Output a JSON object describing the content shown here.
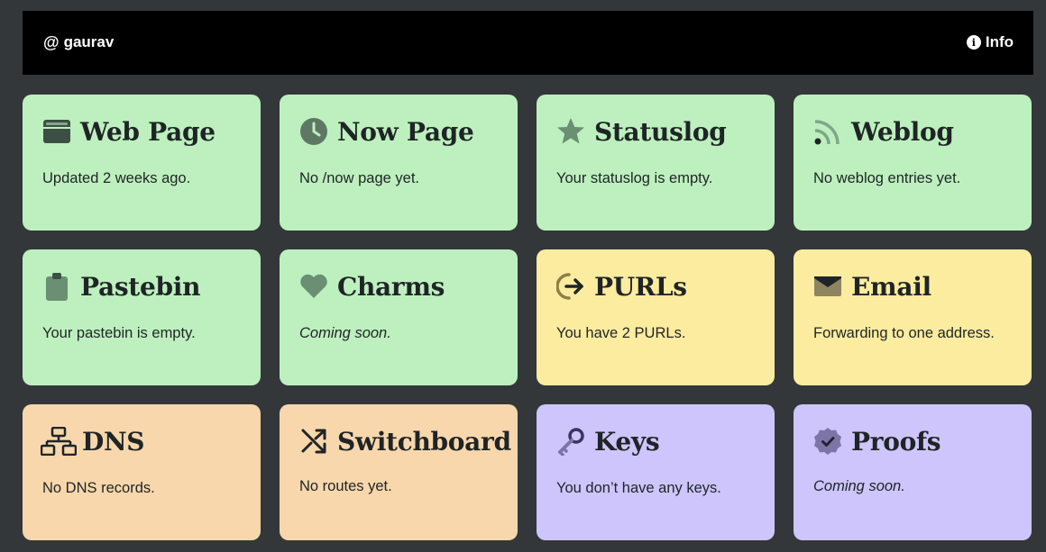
{
  "header": {
    "user_symbol": "@",
    "username": "gaurav",
    "info_label": "Info"
  },
  "cards": [
    {
      "title": "Web Page",
      "description": "Updated 2 weeks ago.",
      "icon": "browser-window-icon",
      "color": "#bdf0be"
    },
    {
      "title": "Now Page",
      "description": "No /now page yet.",
      "icon": "clock-icon",
      "color": "#bdf0be"
    },
    {
      "title": "Statuslog",
      "description": "Your statuslog is empty.",
      "icon": "star-icon",
      "color": "#bdf0be"
    },
    {
      "title": "Weblog",
      "description": "No weblog entries yet.",
      "icon": "rss-icon",
      "color": "#bdf0be"
    },
    {
      "title": "Pastebin",
      "description": "Your pastebin is empty.",
      "icon": "clipboard-icon",
      "color": "#bdf0be"
    },
    {
      "title": "Charms",
      "description": "Coming soon.",
      "icon": "heart-icon",
      "color": "#bdf0be"
    },
    {
      "title": "PURLs",
      "description": "You have 2 PURLs.",
      "icon": "redirect-arrow-icon",
      "color": "#fcec9f"
    },
    {
      "title": "Email",
      "description": "Forwarding to one address.",
      "icon": "envelope-icon",
      "color": "#fcec9f"
    },
    {
      "title": "DNS",
      "description": "No DNS records.",
      "icon": "network-icon",
      "color": "#f7d7ab"
    },
    {
      "title": "Switchboard",
      "description": "No routes yet.",
      "icon": "shuffle-icon",
      "color": "#f7d7ab"
    },
    {
      "title": "Keys",
      "description": "You don’t have any keys.",
      "icon": "key-icon",
      "color": "#cdc5fb"
    },
    {
      "title": "Proofs",
      "description": "Coming soon.",
      "icon": "certificate-check-icon",
      "color": "#cdc5fb"
    }
  ]
}
